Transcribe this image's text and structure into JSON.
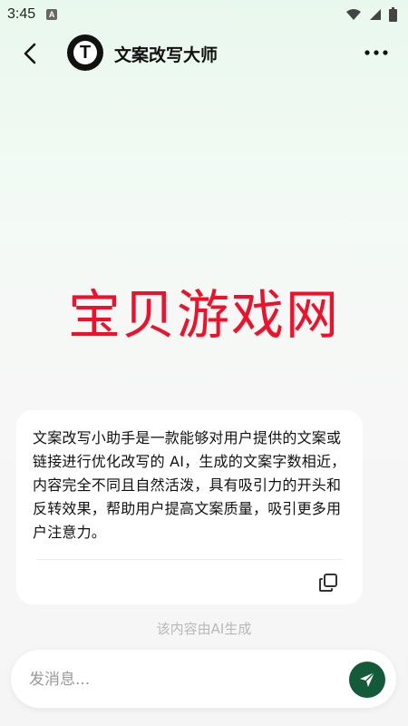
{
  "status_bar": {
    "time": "3:45",
    "app_indicator": "A"
  },
  "header": {
    "title": "文案改写大师",
    "avatar_letter": "T"
  },
  "watermark": "宝贝游戏网",
  "message": {
    "text": "文案改写小助手是一款能够对用户提供的文案或链接进行优化改写的 AI，生成的文案字数相近，内容完全不同且自然活泼，具有吸引力的开头和反转效果，帮助用户提高文案质量，吸引更多用户注意力。"
  },
  "ai_note": "该内容由AI生成",
  "input": {
    "placeholder": "发消息..."
  },
  "colors": {
    "accent": "#125a38",
    "watermark": "#f0102a"
  },
  "icons": {
    "back": "chevron-left-icon",
    "more": "more-dots-icon",
    "copy": "copy-icon",
    "send": "send-icon",
    "wifi": "wifi-icon",
    "signal": "signal-icon",
    "battery": "battery-icon"
  }
}
